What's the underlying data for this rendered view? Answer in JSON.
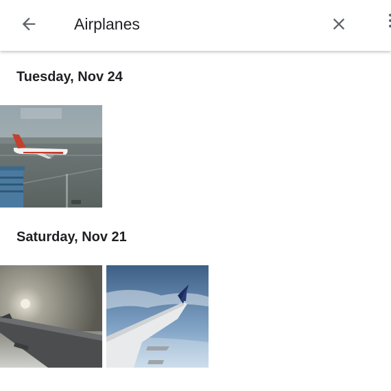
{
  "search": {
    "query": "Airplanes"
  },
  "icons": {
    "back": "arrow-left-icon",
    "clear": "close-icon",
    "more": "more-vert-icon"
  },
  "sections": [
    {
      "date": "Tuesday, Nov 24",
      "photos": [
        "Airplane on runway"
      ]
    },
    {
      "date": "Saturday, Nov 21",
      "photos": [
        "Wing above clouds",
        "Wing against blue sky"
      ]
    }
  ],
  "colors": {
    "text": "#202124",
    "icon": "#5f6368"
  }
}
